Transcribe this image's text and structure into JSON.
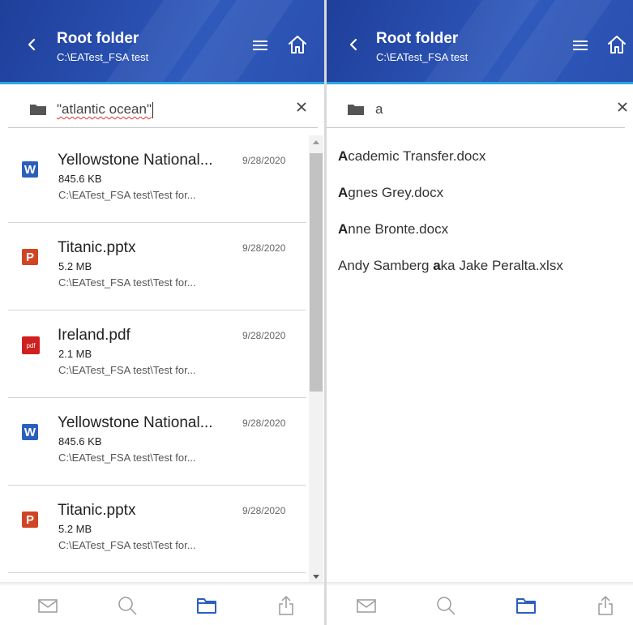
{
  "panes": {
    "left": {
      "header": {
        "title": "Root folder",
        "path": "C:\\EATest_FSA test"
      },
      "search": {
        "value": "\"atlantic ocean\"",
        "caret": "|"
      },
      "results": [
        {
          "icon": "word-file-icon",
          "icon_label": "W",
          "name": "Yellowstone National...",
          "size": "845.6 KB",
          "path": "C:\\EATest_FSA test\\Test for...",
          "date": "9/28/2020"
        },
        {
          "icon": "powerpoint-file-icon",
          "icon_label": "P",
          "name": "Titanic.pptx",
          "size": "5.2 MB",
          "path": "C:\\EATest_FSA test\\Test for...",
          "date": "9/28/2020"
        },
        {
          "icon": "pdf-file-icon",
          "icon_label": "pdf",
          "name": "Ireland.pdf",
          "size": "2.1 MB",
          "path": "C:\\EATest_FSA test\\Test for...",
          "date": "9/28/2020"
        },
        {
          "icon": "word-file-icon",
          "icon_label": "W",
          "name": "Yellowstone National...",
          "size": "845.6 KB",
          "path": "C:\\EATest_FSA test\\Test for...",
          "date": "9/28/2020"
        },
        {
          "icon": "powerpoint-file-icon",
          "icon_label": "P",
          "name": "Titanic.pptx",
          "size": "5.2 MB",
          "path": "C:\\EATest_FSA test\\Test for...",
          "date": "9/28/2020"
        }
      ]
    },
    "right": {
      "header": {
        "title": "Root folder",
        "path": "C:\\EATest_FSA test"
      },
      "search": {
        "value": "a"
      },
      "suggestions": [
        {
          "parts": [
            {
              "text": "A",
              "bold": true
            },
            {
              "text": "cademic Transfer.docx",
              "bold": false
            }
          ]
        },
        {
          "parts": [
            {
              "text": "A",
              "bold": true
            },
            {
              "text": "gnes Grey.docx",
              "bold": false
            }
          ]
        },
        {
          "parts": [
            {
              "text": "A",
              "bold": true
            },
            {
              "text": "nne Bronte.docx",
              "bold": false
            }
          ]
        },
        {
          "parts": [
            {
              "text": "Andy Samberg ",
              "bold": false
            },
            {
              "text": "a",
              "bold": true
            },
            {
              "text": "ka Jake Peralta.xlsx",
              "bold": false
            }
          ]
        }
      ]
    }
  },
  "bottom_nav": [
    "mail-icon",
    "search-icon",
    "folder-icon",
    "share-icon"
  ],
  "colors": {
    "header": "#2a51b3",
    "accent": "#29a8e0",
    "active_nav": "#2b5fbd",
    "inactive_nav": "#9a9a9a",
    "word": "#2b5fbd",
    "powerpoint": "#d14424",
    "pdf": "#d01f1f"
  }
}
